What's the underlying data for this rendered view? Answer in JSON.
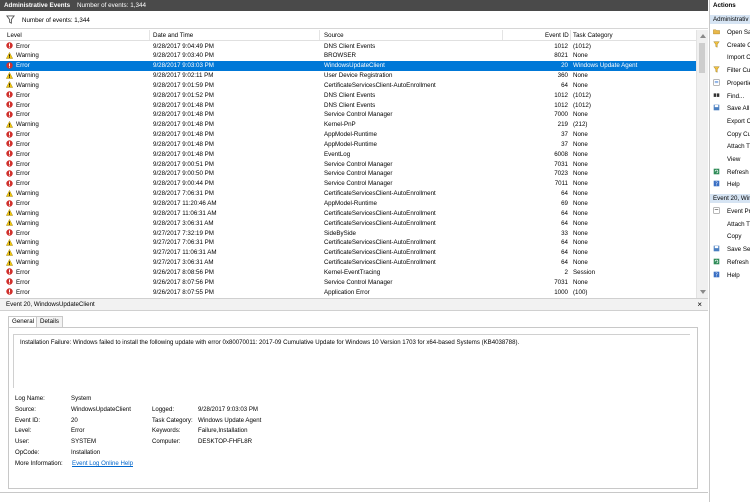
{
  "titlebar": {
    "title": "Administrative Events",
    "count": "Number of events: 1,344"
  },
  "filterbar": {
    "text": "Number of events: 1,344"
  },
  "columns": {
    "level": "Level",
    "date": "Date and Time",
    "source": "Source",
    "event_id": "Event ID",
    "task": "Task Category"
  },
  "rows": [
    {
      "level": "Error",
      "date": "9/28/2017 9:04:49 PM",
      "source": "DNS Client Events",
      "id": "1012",
      "task": "(1012)"
    },
    {
      "level": "Warning",
      "date": "9/28/2017 9:03:40 PM",
      "source": "BROWSER",
      "id": "8021",
      "task": "None"
    },
    {
      "level": "Error",
      "date": "9/28/2017 9:03:03 PM",
      "source": "WindowsUpdateClient",
      "id": "20",
      "task": "Windows Update Agent",
      "selected": true
    },
    {
      "level": "Warning",
      "date": "9/28/2017 9:02:11 PM",
      "source": "User Device Registration",
      "id": "360",
      "task": "None"
    },
    {
      "level": "Warning",
      "date": "9/28/2017 9:01:59 PM",
      "source": "CertificateServicesClient-AutoEnrollment",
      "id": "64",
      "task": "None"
    },
    {
      "level": "Error",
      "date": "9/28/2017 9:01:52 PM",
      "source": "DNS Client Events",
      "id": "1012",
      "task": "(1012)"
    },
    {
      "level": "Error",
      "date": "9/28/2017 9:01:48 PM",
      "source": "DNS Client Events",
      "id": "1012",
      "task": "(1012)"
    },
    {
      "level": "Error",
      "date": "9/28/2017 9:01:48 PM",
      "source": "Service Control Manager",
      "id": "7000",
      "task": "None"
    },
    {
      "level": "Warning",
      "date": "9/28/2017 9:01:48 PM",
      "source": "Kernel-PnP",
      "id": "219",
      "task": "(212)"
    },
    {
      "level": "Error",
      "date": "9/28/2017 9:01:48 PM",
      "source": "AppModel-Runtime",
      "id": "37",
      "task": "None"
    },
    {
      "level": "Error",
      "date": "9/28/2017 9:01:48 PM",
      "source": "AppModel-Runtime",
      "id": "37",
      "task": "None"
    },
    {
      "level": "Error",
      "date": "9/28/2017 9:01:48 PM",
      "source": "EventLog",
      "id": "6008",
      "task": "None"
    },
    {
      "level": "Error",
      "date": "9/28/2017 9:00:51 PM",
      "source": "Service Control Manager",
      "id": "7031",
      "task": "None"
    },
    {
      "level": "Error",
      "date": "9/28/2017 9:00:50 PM",
      "source": "Service Control Manager",
      "id": "7023",
      "task": "None"
    },
    {
      "level": "Error",
      "date": "9/28/2017 9:00:44 PM",
      "source": "Service Control Manager",
      "id": "7011",
      "task": "None"
    },
    {
      "level": "Warning",
      "date": "9/28/2017 7:06:31 PM",
      "source": "CertificateServicesClient-AutoEnrollment",
      "id": "64",
      "task": "None"
    },
    {
      "level": "Error",
      "date": "9/28/2017 11:20:46 AM",
      "source": "AppModel-Runtime",
      "id": "69",
      "task": "None"
    },
    {
      "level": "Warning",
      "date": "9/28/2017 11:06:31 AM",
      "source": "CertificateServicesClient-AutoEnrollment",
      "id": "64",
      "task": "None"
    },
    {
      "level": "Warning",
      "date": "9/28/2017 3:06:31 AM",
      "source": "CertificateServicesClient-AutoEnrollment",
      "id": "64",
      "task": "None"
    },
    {
      "level": "Error",
      "date": "9/27/2017 7:32:19 PM",
      "source": "SideBySide",
      "id": "33",
      "task": "None"
    },
    {
      "level": "Warning",
      "date": "9/27/2017 7:06:31 PM",
      "source": "CertificateServicesClient-AutoEnrollment",
      "id": "64",
      "task": "None"
    },
    {
      "level": "Warning",
      "date": "9/27/2017 11:06:31 AM",
      "source": "CertificateServicesClient-AutoEnrollment",
      "id": "64",
      "task": "None"
    },
    {
      "level": "Warning",
      "date": "9/27/2017 3:06:31 AM",
      "source": "CertificateServicesClient-AutoEnrollment",
      "id": "64",
      "task": "None"
    },
    {
      "level": "Error",
      "date": "9/26/2017 8:08:56 PM",
      "source": "Kernel-EventTracing",
      "id": "2",
      "task": "Session"
    },
    {
      "level": "Error",
      "date": "9/26/2017 8:07:56 PM",
      "source": "Service Control Manager",
      "id": "7031",
      "task": "None"
    },
    {
      "level": "Error",
      "date": "9/26/2017 8:07:55 PM",
      "source": "Application Error",
      "id": "1000",
      "task": "(100)"
    }
  ],
  "details": {
    "header": "Event 20, WindowsUpdateClient",
    "close": "×",
    "tab_general": "General",
    "tab_details": "Details",
    "message": "Installation Failure: Windows failed to install the following update with error 0x80070011: 2017-09 Cumulative Update for Windows 10 Version 1703 for x64-based Systems (KB4038788).",
    "log_name_label": "Log Name:",
    "log_name": "System",
    "source_label": "Source:",
    "source": "WindowsUpdateClient",
    "logged_label": "Logged:",
    "logged": "9/28/2017 9:03:03 PM",
    "event_id_label": "Event ID:",
    "event_id": "20",
    "task_cat_label": "Task Category:",
    "task_cat": "Windows Update Agent",
    "level_label": "Level:",
    "level": "Error",
    "keywords_label": "Keywords:",
    "keywords": "Failure,Installation",
    "user_label": "User:",
    "user": "SYSTEM",
    "computer_label": "Computer:",
    "computer": "DESKTOP-FHFL8R",
    "opcode_label": "OpCode:",
    "opcode": "Installation",
    "more_info_label": "More Information:",
    "more_info": "Event Log Online Help"
  },
  "actions": {
    "header": "Actions",
    "section1": "Administrativ",
    "items1": [
      {
        "label": "Open Sa",
        "icon": "folder-icon"
      },
      {
        "label": "Create C",
        "icon": "filter-create-icon"
      },
      {
        "label": "Import C",
        "icon": "import-icon"
      },
      {
        "label": "Filter Cu",
        "icon": "filter-icon"
      },
      {
        "label": "Propertie",
        "icon": "properties-icon"
      },
      {
        "label": "Find...",
        "icon": "find-icon"
      },
      {
        "label": "Save All",
        "icon": "save-icon"
      },
      {
        "label": "Export C",
        "icon": "export-icon"
      },
      {
        "label": "Copy Cu",
        "icon": "copy-icon"
      },
      {
        "label": "Attach T",
        "icon": "attach-task-icon"
      },
      {
        "label": "View",
        "icon": "view-icon"
      },
      {
        "label": "Refresh",
        "icon": "refresh-icon"
      },
      {
        "label": "Help",
        "icon": "help-icon"
      }
    ],
    "section2": "Event 20, Win",
    "items2": [
      {
        "label": "Event Pro",
        "icon": "event-properties-icon"
      },
      {
        "label": "Attach T",
        "icon": "attach-task-icon"
      },
      {
        "label": "Copy",
        "icon": "copy-icon"
      },
      {
        "label": "Save Sele",
        "icon": "save-icon"
      },
      {
        "label": "Refresh",
        "icon": "refresh-icon"
      },
      {
        "label": "Help",
        "icon": "help-icon"
      }
    ]
  },
  "colors": {
    "selection": "#0078d7",
    "error": "#d0312d",
    "warning": "#f2c811",
    "link": "#0066cc"
  }
}
